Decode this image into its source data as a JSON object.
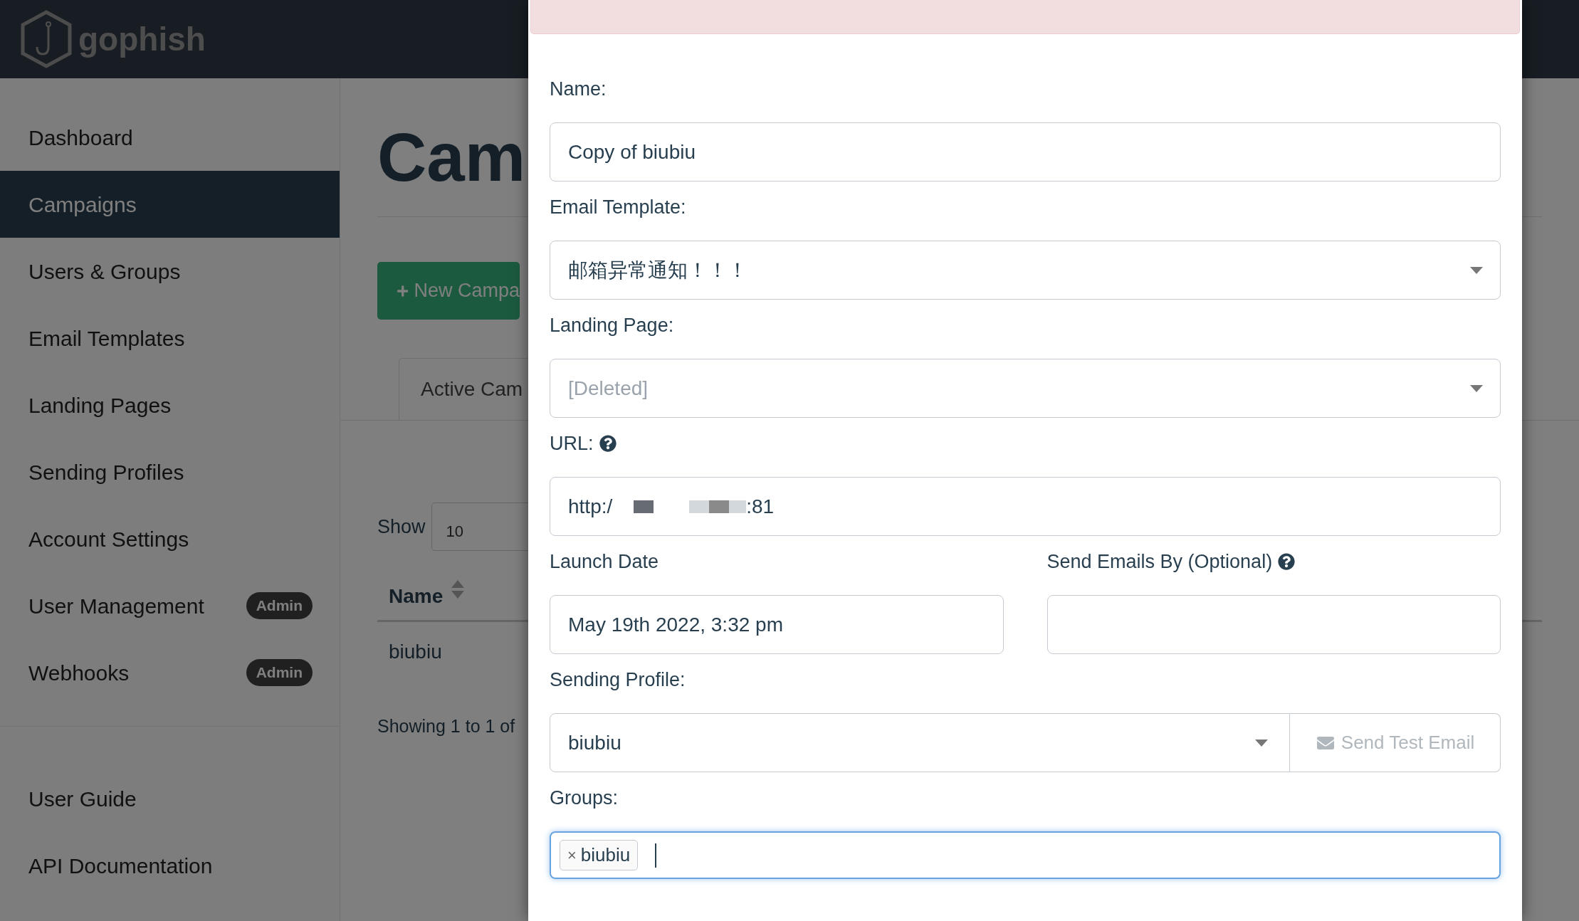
{
  "brand": "gophish",
  "sidebar": {
    "items": [
      {
        "label": "Dashboard",
        "selected": false
      },
      {
        "label": "Campaigns",
        "selected": true
      },
      {
        "label": "Users & Groups",
        "selected": false
      },
      {
        "label": "Email Templates",
        "selected": false
      },
      {
        "label": "Landing Pages",
        "selected": false
      },
      {
        "label": "Sending Profiles",
        "selected": false
      },
      {
        "label": "Account Settings",
        "selected": false
      },
      {
        "label": "User Management",
        "selected": false,
        "badge": "Admin"
      },
      {
        "label": "Webhooks",
        "selected": false,
        "badge": "Admin"
      }
    ],
    "footer_items": [
      {
        "label": "User Guide"
      },
      {
        "label": "API Documentation"
      }
    ]
  },
  "main": {
    "title": "Cam",
    "new_button": "New Campa",
    "tab": "Active Cam",
    "show_label": "Show",
    "show_value": "10",
    "table": {
      "columns": [
        {
          "label": "Name"
        }
      ],
      "rows": [
        {
          "name": "biubiu"
        }
      ]
    },
    "footer": "Showing 1 to 1 of"
  },
  "modal": {
    "name": {
      "label": "Name:",
      "value": "Copy of biubiu"
    },
    "template": {
      "label": "Email Template:",
      "value": "邮箱异常通知！！！"
    },
    "landing_page": {
      "label": "Landing Page:",
      "value": "[Deleted]",
      "disabled": true
    },
    "url": {
      "label": "URL:",
      "prefix": "http:/",
      "suffix": ":81"
    },
    "launch_date": {
      "label": "Launch Date",
      "value": "May 19th 2022, 3:32 pm"
    },
    "send_by": {
      "label": "Send Emails By (Optional)"
    },
    "sending_profile": {
      "label": "Sending Profile:",
      "value": "biubiu",
      "button": "Send Test Email",
      "button_disabled": true
    },
    "groups": {
      "label": "Groups:",
      "focused": true,
      "tags": [
        {
          "label": "biubiu",
          "remove": "×"
        }
      ]
    }
  }
}
